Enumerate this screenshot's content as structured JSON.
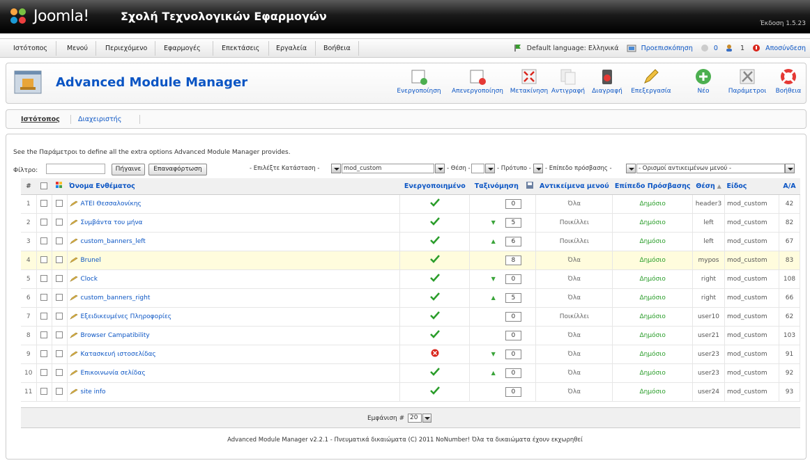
{
  "header": {
    "brand": "Joomla!",
    "site_title": "Σχολή Τεχνολογικών Εφαρμογών",
    "version": "Έκδοση 1.5.23"
  },
  "menu": [
    "Ιστότοπος",
    "Μενού",
    "Περιεχόμενο",
    "Εφαρμογές",
    "Επεκτάσεις",
    "Εργαλεία",
    "Βοήθεια"
  ],
  "status": {
    "language": "Default language: Ελληνικά",
    "preview": "Προεπισκόπηση",
    "messages": "0",
    "users": "1",
    "logout": "Αποσύνδεση"
  },
  "toolbar": {
    "title": "Advanced Module Manager",
    "buttons": [
      "Ενεργοποίηση",
      "Απενεργοποίηση",
      "Μετακίνηση",
      "Αντιγραφή",
      "Διαγραφή",
      "Επεξεργασία",
      "Νέο",
      "Παράμετροι",
      "Βοήθεια"
    ]
  },
  "subnav": {
    "site": "Ιστότοπος",
    "admin": "Διαχειριστής"
  },
  "info": "See the Παράμετροι to define all the extra options Advanced Module Manager provides.",
  "filter": {
    "label": "Φίλτρο:",
    "go": "Πήγαινε",
    "reset": "Επαναφόρτωση",
    "state": "- Επιλέξτε Κατάσταση -",
    "type": "mod_custom",
    "position": "- Θέση -",
    "template": "- Πρότυπο -",
    "access": "- Επίπεδο πρόσβασης -",
    "menu_items": "- Ορισμοί αντικειμένων μενού -"
  },
  "columns": {
    "num": "#",
    "name": "Όνομα Ενθέματος",
    "enabled": "Ενεργοποιημένο",
    "order": "Ταξινόμηση",
    "menu": "Αντικείμενα μενού",
    "access": "Επίπεδο Πρόσβασης",
    "position": "Θέση",
    "type": "Είδος",
    "id": "Α/Α"
  },
  "rows": [
    {
      "n": "1",
      "name": "ΑΤΕΙ Θεσσαλονίκης",
      "enabled": true,
      "up": false,
      "down": false,
      "order": "0",
      "menu": "Όλα",
      "access": "Δημόσιο",
      "position": "header3",
      "type": "mod_custom",
      "id": "42"
    },
    {
      "n": "2",
      "name": "Συμβάντα του μήνα",
      "enabled": true,
      "up": false,
      "down": true,
      "order": "5",
      "menu": "Ποικίλλει",
      "access": "Δημόσιο",
      "position": "left",
      "type": "mod_custom",
      "id": "82"
    },
    {
      "n": "3",
      "name": "custom_banners_left",
      "enabled": true,
      "up": true,
      "down": false,
      "order": "6",
      "menu": "Ποικίλλει",
      "access": "Δημόσιο",
      "position": "left",
      "type": "mod_custom",
      "id": "67"
    },
    {
      "n": "4",
      "name": "Brunel",
      "enabled": true,
      "up": false,
      "down": false,
      "order": "8",
      "menu": "Όλα",
      "access": "Δημόσιο",
      "position": "mypos",
      "type": "mod_custom",
      "id": "83"
    },
    {
      "n": "5",
      "name": "Clock",
      "enabled": true,
      "up": false,
      "down": true,
      "order": "0",
      "menu": "Όλα",
      "access": "Δημόσιο",
      "position": "right",
      "type": "mod_custom",
      "id": "108"
    },
    {
      "n": "6",
      "name": "custom_banners_right",
      "enabled": true,
      "up": true,
      "down": false,
      "order": "5",
      "menu": "Όλα",
      "access": "Δημόσιο",
      "position": "right",
      "type": "mod_custom",
      "id": "66"
    },
    {
      "n": "7",
      "name": "Εξειδικευμένες Πληροφορίες",
      "enabled": true,
      "up": false,
      "down": false,
      "order": "0",
      "menu": "Ποικίλλει",
      "access": "Δημόσιο",
      "position": "user10",
      "type": "mod_custom",
      "id": "62"
    },
    {
      "n": "8",
      "name": "Browser Campatibility",
      "enabled": true,
      "up": false,
      "down": false,
      "order": "0",
      "menu": "Όλα",
      "access": "Δημόσιο",
      "position": "user21",
      "type": "mod_custom",
      "id": "103"
    },
    {
      "n": "9",
      "name": "Κατασκευή ιστοσελίδας",
      "enabled": false,
      "up": false,
      "down": true,
      "order": "0",
      "menu": "Όλα",
      "access": "Δημόσιο",
      "position": "user23",
      "type": "mod_custom",
      "id": "91"
    },
    {
      "n": "10",
      "name": "Επικοινωνία σελίδας",
      "enabled": true,
      "up": true,
      "down": false,
      "order": "0",
      "menu": "Όλα",
      "access": "Δημόσιο",
      "position": "user23",
      "type": "mod_custom",
      "id": "92"
    },
    {
      "n": "11",
      "name": "site info",
      "enabled": true,
      "up": false,
      "down": false,
      "order": "0",
      "menu": "Όλα",
      "access": "Δημόσιο",
      "position": "user24",
      "type": "mod_custom",
      "id": "93"
    }
  ],
  "pagination": {
    "label": "Εμφάνιση #",
    "value": "20"
  },
  "footer": "Advanced Module Manager v2.2.1 - Πνευματικά δικαιώματα (C) 2011 NoNumber! Όλα τα δικαιώματα έχουν εκχωρηθεί",
  "colors": {
    "link": "#0b55c4",
    "enabled": "#2a9d2a",
    "disabled": "#d9261c",
    "highlight": "#fffcdd"
  }
}
